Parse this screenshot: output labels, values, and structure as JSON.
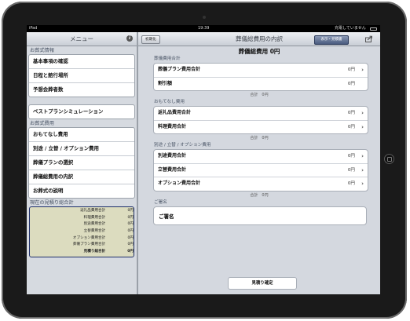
{
  "status_bar": {
    "device": "iPad",
    "time": "19:39",
    "battery_text": "充電していません"
  },
  "sidebar": {
    "title": "メニュー",
    "sections": [
      {
        "label": "お葬式情報",
        "items": [
          "基本事項の確認",
          "日程と館行場所",
          "予想会葬者数"
        ]
      },
      {
        "label": "",
        "items": [
          "ベストプランシミュレーション"
        ]
      },
      {
        "label": "お葬式費用",
        "items": [
          "おもてなし費用",
          "別途 / 立替 / オプション費用",
          "葬儀プランの選択",
          "葬儀総費用の内訳",
          "お葬式の説明"
        ]
      }
    ],
    "estimate": {
      "label": "現在の見積り総合計",
      "rows": [
        {
          "label": "返礼品費用合計",
          "value": "0円"
        },
        {
          "label": "料理費用合計",
          "value": "0円"
        },
        {
          "label": "別途費用合計",
          "value": "0円"
        },
        {
          "label": "立替費用合計",
          "value": "0円"
        },
        {
          "label": "オプション費用合計",
          "value": "0円"
        },
        {
          "label": "葬儀プラン費用合計",
          "value": "0円"
        },
        {
          "label": "見積り総合計",
          "value": "0円"
        }
      ]
    }
  },
  "main": {
    "title": "葬儀総費用の内訳",
    "init_button": "初期化",
    "segment_button": "表示・見積書",
    "grand_total": "葬儀総費用 0円",
    "groups": [
      {
        "label": "葬儀費用合計",
        "rows": [
          {
            "label": "葬儀プラン費用合計",
            "value": "0円",
            "chevron": true
          },
          {
            "label": "割引額",
            "value": "0円",
            "chevron": false
          }
        ],
        "subtotal": "合計　0円"
      },
      {
        "label": "おもてなし費用",
        "rows": [
          {
            "label": "返礼品費用合計",
            "value": "0円",
            "chevron": true
          },
          {
            "label": "料理費用合計",
            "value": "0円",
            "chevron": true
          }
        ],
        "subtotal": "合計　0円"
      },
      {
        "label": "別途 / 立替 / オプション費用",
        "rows": [
          {
            "label": "別途費用合計",
            "value": "0円",
            "chevron": true
          },
          {
            "label": "立替費用合計",
            "value": "0円",
            "chevron": true
          },
          {
            "label": "オプション費用合計",
            "value": "0円",
            "chevron": true
          }
        ],
        "subtotal": "合計　0円"
      }
    ],
    "signature": {
      "label": "ご署名",
      "field": "ご署名"
    },
    "confirm_button": "見積り確定",
    "chevron_glyph": "›"
  },
  "colors": {
    "accent": "#1f2f6a",
    "estimate_bg": "#dcdcbf"
  }
}
